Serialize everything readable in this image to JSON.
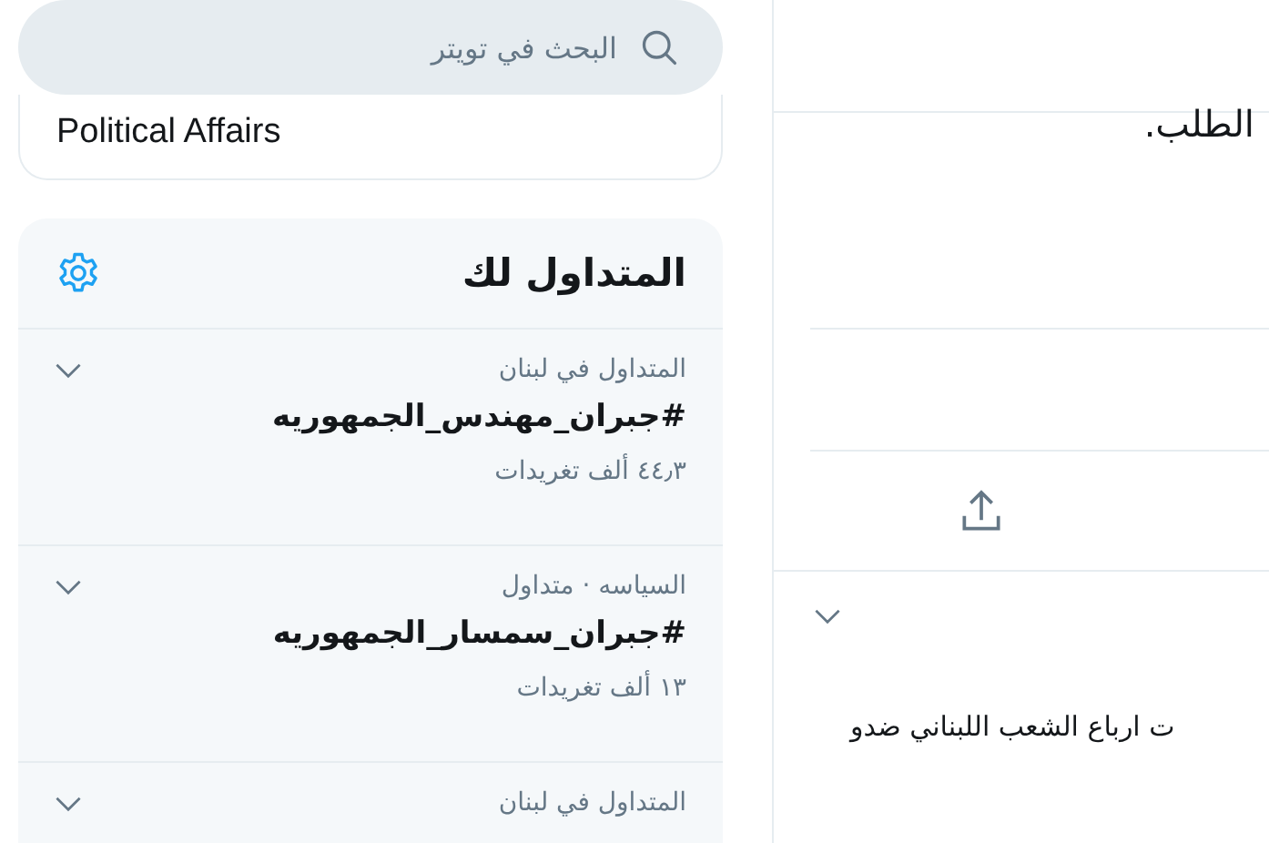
{
  "search": {
    "placeholder": "البحث في تويتر"
  },
  "topics_card": {
    "item": "Political Affairs"
  },
  "trends": {
    "title": "المتداول لك",
    "items": [
      {
        "context": "المتداول في لبنان",
        "hashtag": "#جبران_مهندس_الجمهوريه",
        "count": "٤٤٫٣ ألف تغريدات"
      },
      {
        "context": "السياسه · متداول",
        "hashtag": "#جبران_سمسار_الجمهوريه",
        "count": "١٣ ألف تغريدات"
      },
      {
        "context": "المتداول في لبنان"
      }
    ]
  },
  "tweet": {
    "text_top": "الطلب.",
    "text_bottom": "ت ارباع الشعب اللبناني ضدو"
  }
}
